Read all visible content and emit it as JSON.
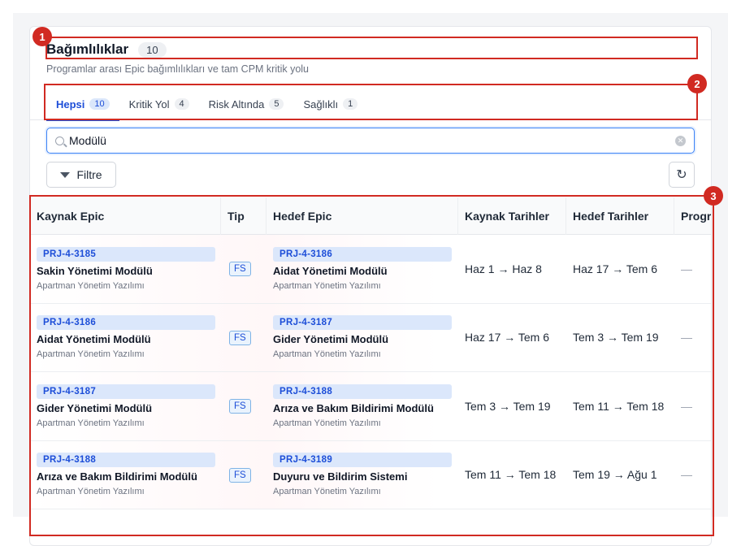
{
  "header": {
    "title": "Bağımlılıklar",
    "count": "10",
    "subtitle": "Programlar arası Epic bağımlılıkları ve tam CPM kritik yolu"
  },
  "tabs": [
    {
      "label": "Hepsi",
      "count": "10"
    },
    {
      "label": "Kritik Yol",
      "count": "4"
    },
    {
      "label": "Risk Altında",
      "count": "5"
    },
    {
      "label": "Sağlıklı",
      "count": "1"
    }
  ],
  "search": {
    "value": "Modülü",
    "placeholder": ""
  },
  "toolbar": {
    "filter_label": "Filtre"
  },
  "table": {
    "columns": [
      "Kaynak Epic",
      "Tip",
      "Hedef Epic",
      "Kaynak Tarihler",
      "Hedef Tarihler",
      "Progr"
    ],
    "rows": [
      {
        "src_id": "PRJ-4-3185",
        "src_name": "Sakin Yönetimi Modülü",
        "src_project": "Apartman Yönetim Yazılımı",
        "tip": "FS",
        "dst_id": "PRJ-4-3186",
        "dst_name": "Aidat Yönetimi Modülü",
        "dst_project": "Apartman Yönetim Yazılımı",
        "src_dates": "Haz 1 → Haz 8",
        "dst_dates": "Haz 17 → Tem 6",
        "progress": "—"
      },
      {
        "src_id": "PRJ-4-3186",
        "src_name": "Aidat Yönetimi Modülü",
        "src_project": "Apartman Yönetim Yazılımı",
        "tip": "FS",
        "dst_id": "PRJ-4-3187",
        "dst_name": "Gider Yönetimi Modülü",
        "dst_project": "Apartman Yönetim Yazılımı",
        "src_dates": "Haz 17 → Tem 6",
        "dst_dates": "Tem 3 → Tem 19",
        "progress": "—"
      },
      {
        "src_id": "PRJ-4-3187",
        "src_name": "Gider Yönetimi Modülü",
        "src_project": "Apartman Yönetim Yazılımı",
        "tip": "FS",
        "dst_id": "PRJ-4-3188",
        "dst_name": "Arıza ve Bakım Bildirimi Modülü",
        "dst_project": "Apartman Yönetim Yazılımı",
        "src_dates": "Tem 3 → Tem 19",
        "dst_dates": "Tem 11 → Tem 18",
        "progress": "—"
      },
      {
        "src_id": "PRJ-4-3188",
        "src_name": "Arıza ve Bakım Bildirimi Modülü",
        "src_project": "Apartman Yönetim Yazılımı",
        "tip": "FS",
        "dst_id": "PRJ-4-3189",
        "dst_name": "Duyuru ve Bildirim Sistemi",
        "dst_project": "Apartman Yönetim Yazılımı",
        "src_dates": "Tem 11 → Tem 18",
        "dst_dates": "Tem 19 → Ağu 1",
        "progress": "—"
      }
    ]
  },
  "annotations": [
    "1",
    "2",
    "3"
  ],
  "colors": {
    "accent": "#1d4ed8",
    "annotation": "#d12a22"
  }
}
